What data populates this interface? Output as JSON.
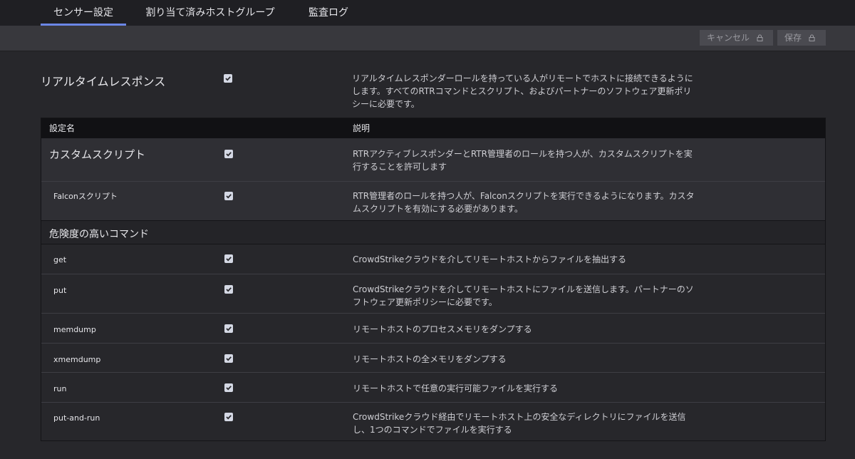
{
  "tabs": [
    {
      "label": "センサー設定",
      "active": true
    },
    {
      "label": "割り当て済みホストグループ",
      "active": false
    },
    {
      "label": "監査ログ",
      "active": false
    }
  ],
  "toolbar": {
    "cancel_label": "キャンセル",
    "save_label": "保存"
  },
  "realtime": {
    "title": "リアルタイムレスポンス",
    "checked": true,
    "description": "リアルタイムレスポンダーロールを持っている人がリモートでホストに接続できるようにします。すべてのRTRコマンドとスクリプト、およびパートナーのソフトウェア更新ポリシーに必要です。"
  },
  "table": {
    "header": {
      "name": "設定名",
      "description": "説明"
    },
    "rows": [
      {
        "name": "カスタムスクリプト",
        "checked": true,
        "description": "RTRアクティブレスポンダーとRTR管理者のロールを持つ人が、カスタムスクリプトを実行することを許可します"
      },
      {
        "name": "Falconスクリプト",
        "checked": true,
        "description": "RTR管理者のロールを持つ人が、Falconスクリプトを実行できるようになります。カスタムスクリプトを有効にする必要があります。"
      }
    ],
    "section_title": "危険度の高いコマンド",
    "commands": [
      {
        "name": "get",
        "checked": true,
        "description": "CrowdStrikeクラウドを介してリモートホストからファイルを抽出する"
      },
      {
        "name": "put",
        "checked": true,
        "description": "CrowdStrikeクラウドを介してリモートホストにファイルを送信します。パートナーのソフトウェア更新ポリシーに必要です。"
      },
      {
        "name": "memdump",
        "checked": true,
        "description": "リモートホストのプロセスメモリをダンプする"
      },
      {
        "name": "xmemdump",
        "checked": true,
        "description": "リモートホストの全メモリをダンプする"
      },
      {
        "name": "run",
        "checked": true,
        "description": "リモートホストで任意の実行可能ファイルを実行する"
      },
      {
        "name": "put-and-run",
        "checked": true,
        "description": "CrowdStrikeクラウド経由でリモートホスト上の安全なディレクトリにファイルを送信し、1つのコマンドでファイルを実行する"
      }
    ]
  }
}
